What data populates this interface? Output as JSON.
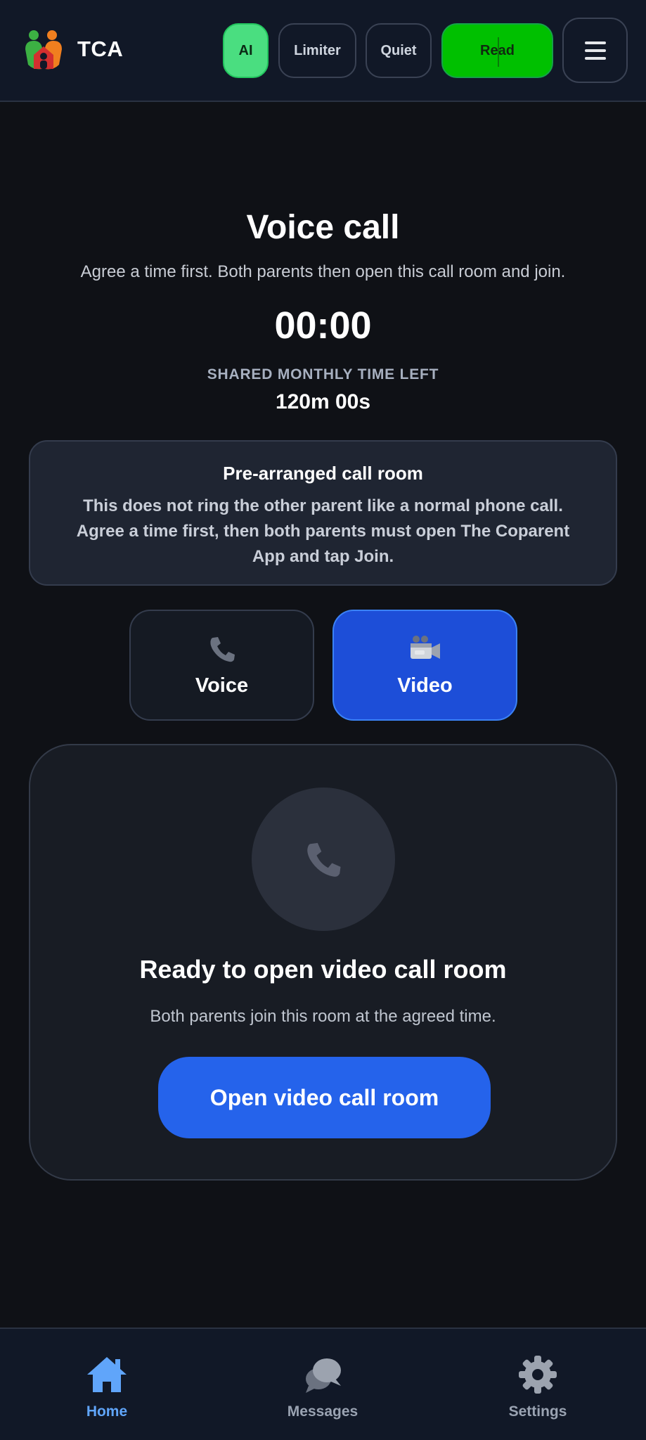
{
  "header": {
    "app_name": "TCA",
    "pills": {
      "ai": "AI",
      "limiter": "Limiter",
      "quiet": "Quiet",
      "read": "Read"
    },
    "menu_icon": "hamburger-icon"
  },
  "call": {
    "title": "Voice call",
    "subtitle": "Agree a time first. Both parents then open this call room and join.",
    "timer": "00:00",
    "shared_label": "SHARED MONTHLY TIME LEFT",
    "shared_value": "120m 00s"
  },
  "notice": {
    "title": "Pre-arranged call room",
    "body": "This does not ring the other parent like a normal phone call. Agree a time first, then both parents must open The Coparent App and tap Join."
  },
  "modes": {
    "voice": {
      "label": "Voice",
      "icon": "phone-icon",
      "selected": false
    },
    "video": {
      "label": "Video",
      "icon": "video-camera-icon",
      "selected": true
    }
  },
  "panel": {
    "title": "Ready to open video call room",
    "subtitle": "Both parents join this room at the agreed time.",
    "button": "Open video call room"
  },
  "nav": {
    "home": "Home",
    "messages": "Messages",
    "settings": "Settings",
    "active": "home"
  },
  "colors": {
    "background": "#0f1116",
    "ai_pill": "#4ade80",
    "read_pill": "#00c000",
    "video_selected": "#1d4ed8",
    "primary_button": "#2563eb",
    "nav_active": "#60a5fa"
  }
}
